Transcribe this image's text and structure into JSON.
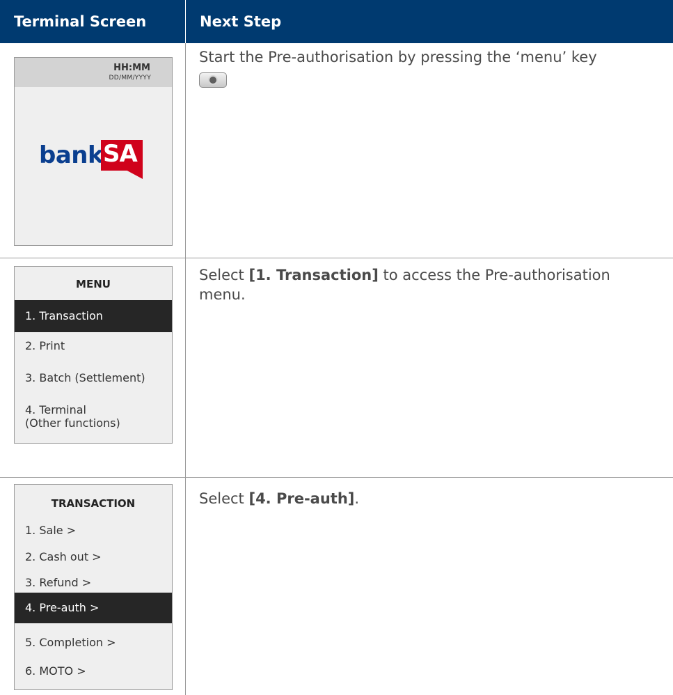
{
  "header": {
    "col1": "Terminal Screen",
    "col2": "Next Step"
  },
  "row1": {
    "time": "HH:MM",
    "date": "DD/MM/YYYY",
    "logo_bank": "bank",
    "logo_sa": "SA",
    "instruction": "Start the Pre-authorisation by pressing the ‘menu’ key",
    "key_icon": "menu-key-icon"
  },
  "row2": {
    "menu_title": "MENU",
    "items": [
      "1. Transaction",
      "2. Print",
      "3. Batch (Settlement)",
      "4. Terminal",
      "(Other functions)"
    ],
    "instruction_prefix": "Select ",
    "instruction_bold": "[1. Transaction]",
    "instruction_suffix": " to access the Pre-authorisation menu."
  },
  "row3": {
    "menu_title": "TRANSACTION",
    "items": [
      "1. Sale >",
      "2. Cash out >",
      "3. Refund >",
      "4. Pre-auth >",
      "5. Completion >",
      "6. MOTO >"
    ],
    "instruction_prefix": "Select ",
    "instruction_bold": "[4. Pre-auth]",
    "instruction_suffix": "."
  },
  "colors": {
    "header_bg": "#003a70",
    "selected_bg": "#262626",
    "logo_blue": "#0b3f8f",
    "logo_red": "#d0021b"
  }
}
